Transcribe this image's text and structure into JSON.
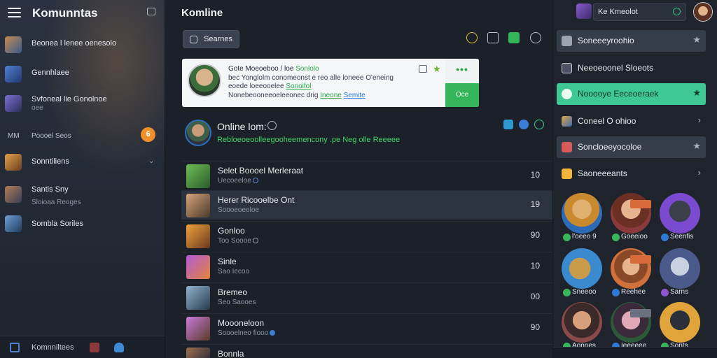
{
  "sidebar": {
    "title": "Komunntas",
    "items": [
      {
        "label": "Beonea l lenee oenesolo",
        "sub": ""
      },
      {
        "label": "Gennhlaee",
        "sub": ""
      },
      {
        "label": "Svfoneal lie Gonolnoe",
        "sub": "oee"
      },
      {
        "label": "Poooel Seos",
        "sub": "",
        "prefix": "MM",
        "badge": "6"
      },
      {
        "label": "Sonntiliens",
        "sub": ""
      },
      {
        "label": "Santis Sny",
        "sub": "Sloioaa Reoges"
      },
      {
        "label": "Sombla Soriles",
        "sub": ""
      }
    ],
    "footer_label": "Komnniltees"
  },
  "center": {
    "title": "Komline",
    "search_label": "Searnes",
    "card": {
      "line1_text": "Gote Moeoeboo / loe",
      "line1_green": "Sonlolo",
      "line2": "bec Yonglolm conomeonst e reo alle loneee O'eneing",
      "line3_text": "eoede loeeooelee",
      "line3_green": "Sonoifol",
      "line4_text": "Nonebeooneeoeleeonec drig",
      "line4_green": "Ineone",
      "line4_blue": "Semite",
      "more": "•••",
      "ok": "Oce"
    },
    "online": {
      "title": "Online lom:",
      "subtitle": "Rebloeoeoolleegooheemencony .pe Neg olle Reeeee"
    },
    "rows": [
      {
        "name": "Selet Boooel Merleraat",
        "desc": "Uecoeeloe",
        "count": "10",
        "selected": false
      },
      {
        "name": "Herer Ricooelbe Ont",
        "desc": "Soooeoeoloe",
        "count": "19",
        "selected": true
      },
      {
        "name": "Gonloo",
        "desc": "Too Soooe",
        "count": "90",
        "selected": false
      },
      {
        "name": "Sinle",
        "desc": "Sao Iecoo",
        "count": "10",
        "selected": false
      },
      {
        "name": "Bremeo",
        "desc": "Seo Saooes",
        "count": "00",
        "selected": false
      },
      {
        "name": "Moooneloon",
        "desc": "Soooelneo fiooo",
        "count": "90",
        "selected": false
      },
      {
        "name": "Bonnla",
        "desc": "",
        "count": "",
        "selected": false
      }
    ]
  },
  "right": {
    "top_pill": "Ke Kmeolot",
    "items": [
      {
        "label": "Soneeeyroohio",
        "tail": "★",
        "style": "bg"
      },
      {
        "label": "Neeoeoonel Sloeots",
        "tail": "",
        "style": ""
      },
      {
        "label": "Nooooye Eeceoeraek",
        "tail": "★",
        "style": "hl"
      },
      {
        "label": "Coneel O ohioo",
        "tail": "›",
        "style": ""
      },
      {
        "label": "Soncloeeyocoloe",
        "tail": "★",
        "style": "bg"
      },
      {
        "label": "Saoneeeants",
        "tail": "›",
        "style": ""
      }
    ],
    "grid": [
      {
        "label": "l'oeeo 9",
        "status": "green"
      },
      {
        "label": "Goeeioo",
        "status": "green"
      },
      {
        "label": "Seenfis",
        "status": "blue"
      },
      {
        "label": "Sneeoo",
        "status": "green"
      },
      {
        "label": "Reehee",
        "status": "blue"
      },
      {
        "label": "Sarns",
        "status": "purple"
      },
      {
        "label": "Aonnes",
        "status": "green"
      },
      {
        "label": "Ieeeeee",
        "status": "blue"
      },
      {
        "label": "Sonts",
        "status": "green"
      }
    ]
  },
  "colors": {
    "accent": "#3fc896",
    "online_green": "#3ed36a",
    "badge_orange": "#f0902a"
  },
  "icons": [
    "menu-icon",
    "edit-icon",
    "search-icon",
    "bell-icon",
    "chat-icon",
    "video-icon",
    "clock-icon",
    "star-icon",
    "chevron-right-icon",
    "check-icon"
  ]
}
